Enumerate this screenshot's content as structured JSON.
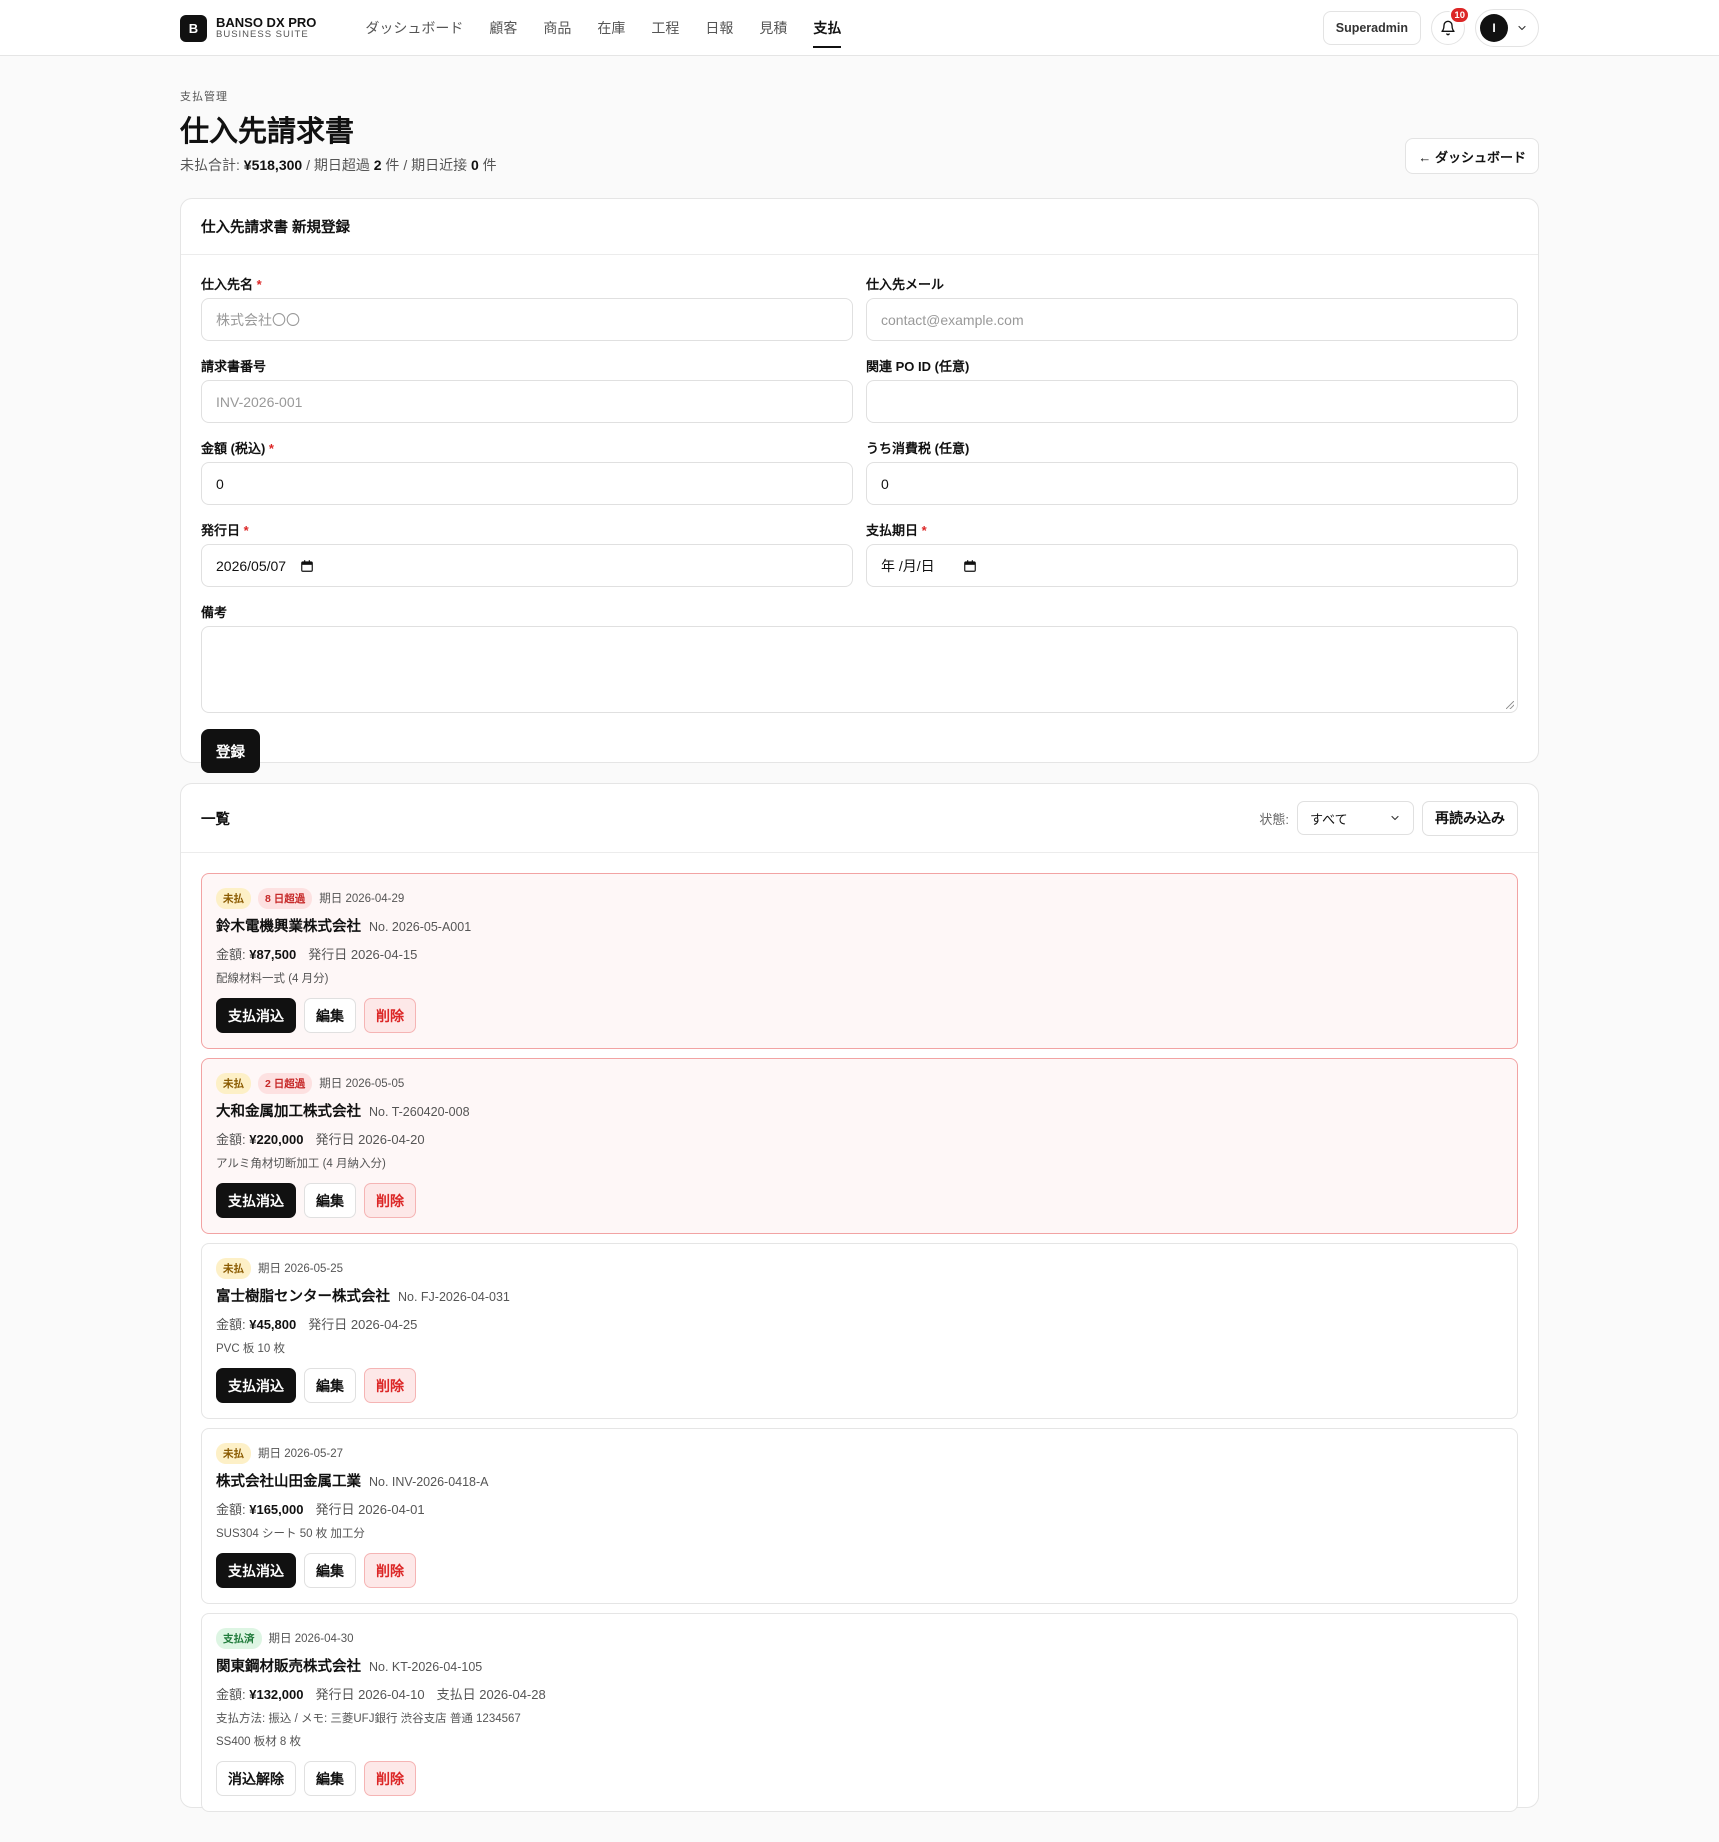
{
  "header": {
    "brand_mark": "B",
    "brand_name": "BANSO DX PRO",
    "brand_sub": "BUSINESS SUITE",
    "nav": [
      "ダッシュボード",
      "顧客",
      "商品",
      "在庫",
      "工程",
      "日報",
      "見積",
      "支払"
    ],
    "active_nav": "支払",
    "role": "Superadmin",
    "notification_count": "10",
    "avatar_initial": "I"
  },
  "page": {
    "kicker": "支払管理",
    "title": "仕入先請求書",
    "summary": {
      "unpaid_label": "未払合計: ",
      "unpaid_total": "¥518,300",
      "overdue_label": " / 期日超過 ",
      "overdue_count": "2",
      "overdue_unit": " 件 / 期日近接 ",
      "near_count": "0",
      "near_unit": " 件"
    },
    "back_button": "← ダッシュボード"
  },
  "form": {
    "title": "仕入先請求書 新規登録",
    "supplier_label": "仕入先名",
    "supplier_placeholder": "株式会社〇〇",
    "email_label": "仕入先メール",
    "email_placeholder": "contact@example.com",
    "invoice_no_label": "請求書番号",
    "invoice_no_placeholder": "INV-2026-001",
    "po_label": "関連 PO ID (任意)",
    "po_value": "",
    "amount_label": "金額 (税込)",
    "amount_value": "0",
    "tax_label": "うち消費税 (任意)",
    "tax_value": "0",
    "issue_label": "発行日",
    "issue_value": "2026/05/07",
    "due_label": "支払期日",
    "due_value": "年 /月/日",
    "note_label": "備考",
    "submit": "登録",
    "required_mark": "*"
  },
  "list": {
    "title": "一覧",
    "filter_label": "状態:",
    "filter_value": "すべて",
    "reload": "再読み込み",
    "labels": {
      "amount": "金額: ",
      "issued": "発行日 ",
      "paid": "支払日 "
    },
    "items": [
      {
        "status": "未払",
        "overdue": "8 日超過",
        "due": "期日 2026-04-29",
        "supplier": "鈴木電機興業株式会社",
        "no": "No. 2026-05-A001",
        "amount": "¥87,500",
        "issued": "2026-04-15",
        "note": "配線材料一式 (4 月分)",
        "actions": [
          "支払消込",
          "編集",
          "削除"
        ]
      },
      {
        "status": "未払",
        "overdue": "2 日超過",
        "due": "期日 2026-05-05",
        "supplier": "大和金属加工株式会社",
        "no": "No. T-260420-008",
        "amount": "¥220,000",
        "issued": "2026-04-20",
        "note": "アルミ角材切断加工 (4 月納入分)",
        "actions": [
          "支払消込",
          "編集",
          "削除"
        ]
      },
      {
        "status": "未払",
        "due": "期日 2026-05-25",
        "supplier": "富士樹脂センター株式会社",
        "no": "No. FJ-2026-04-031",
        "amount": "¥45,800",
        "issued": "2026-04-25",
        "note": "PVC 板 10 枚",
        "actions": [
          "支払消込",
          "編集",
          "削除"
        ]
      },
      {
        "status": "未払",
        "due": "期日 2026-05-27",
        "supplier": "株式会社山田金属工業",
        "no": "No. INV-2026-0418-A",
        "amount": "¥165,000",
        "issued": "2026-04-01",
        "note": "SUS304 シート 50 枚 加工分",
        "actions": [
          "支払消込",
          "編集",
          "削除"
        ]
      },
      {
        "status": "支払済",
        "due": "期日 2026-04-30",
        "supplier": "関東鋼材販売株式会社",
        "no": "No. KT-2026-04-105",
        "amount": "¥132,000",
        "issued": "2026-04-10",
        "paid": "2026-04-28",
        "payment_note": "支払方法: 振込 / メモ: 三菱UFJ銀行 渋谷支店 普通 1234567",
        "note": "SS400 板材 8 枚",
        "actions": [
          "消込解除",
          "編集",
          "削除"
        ]
      }
    ]
  },
  "colors": {
    "accent": "#111111",
    "danger": "#dc2626",
    "overdue_bg": "#fef7f7",
    "unpaid_badge": "#fdf0c7",
    "paid_badge": "#ddf5e3"
  }
}
